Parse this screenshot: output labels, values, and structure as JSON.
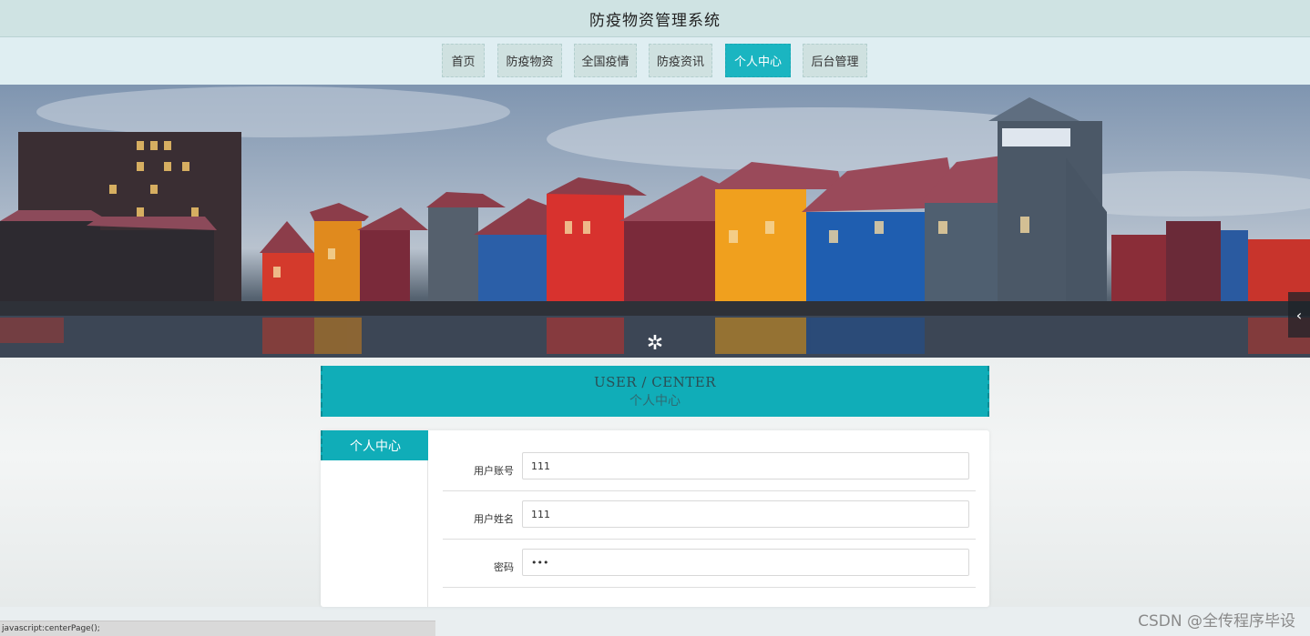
{
  "header": {
    "title": "防疫物资管理系统"
  },
  "nav": {
    "items": [
      {
        "label": "首页"
      },
      {
        "label": "防疫物资"
      },
      {
        "label": "全国疫情"
      },
      {
        "label": "防疫资讯"
      },
      {
        "label": "个人中心",
        "active": true
      },
      {
        "label": "后台管理"
      }
    ]
  },
  "banner": {
    "prev_icon": "chevron-left-icon",
    "prev_glyph": "‹"
  },
  "user_center": {
    "title_en": "USER / CENTER",
    "title_cn": "个人中心",
    "side_menu": [
      {
        "label": "个人中心",
        "active": true
      }
    ],
    "fields": [
      {
        "label": "用户账号",
        "value": "111",
        "type": "text"
      },
      {
        "label": "用户姓名",
        "value": "111",
        "type": "text"
      },
      {
        "label": "密码",
        "value": "111",
        "type": "password"
      }
    ]
  },
  "status_bar": {
    "text": "javascript:centerPage();"
  },
  "watermark": {
    "text": "CSDN @全传程序毕设"
  },
  "colors": {
    "accent": "#10adb8",
    "nav_bg": "#cfe1e0",
    "header_bg": "#cfe3e3"
  }
}
